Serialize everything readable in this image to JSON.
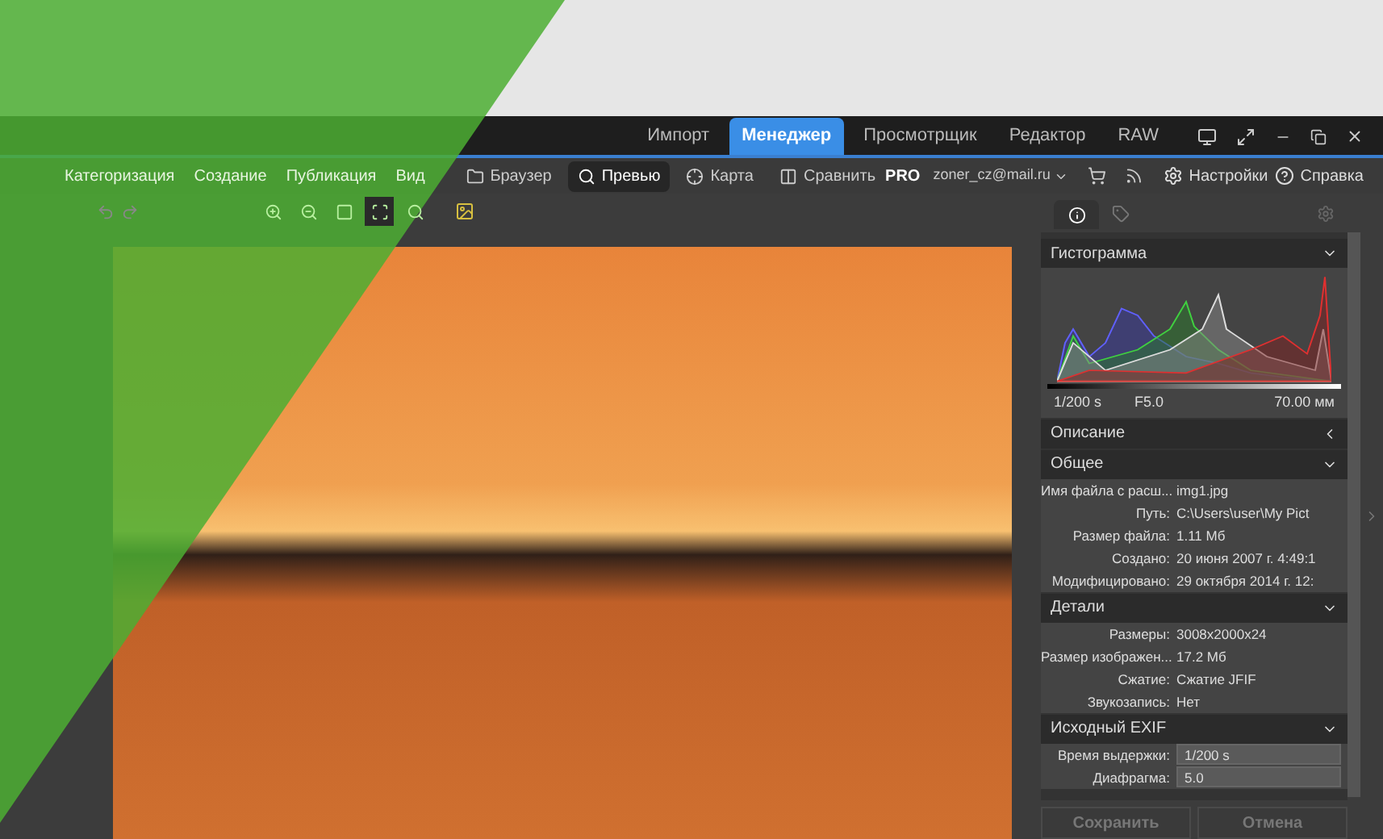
{
  "modules": [
    {
      "label": "Импорт",
      "selected": false
    },
    {
      "label": "Менеджер",
      "selected": true
    },
    {
      "label": "Просмотрщик",
      "selected": false
    },
    {
      "label": "Редактор",
      "selected": false
    },
    {
      "label": "RAW",
      "selected": false
    }
  ],
  "menu": [
    "Категоризация",
    "Создание",
    "Публикация",
    "Вид"
  ],
  "views": [
    {
      "label": "Браузер",
      "selected": false,
      "kind": "folder"
    },
    {
      "label": "Превью",
      "selected": true,
      "kind": "magnifier"
    },
    {
      "label": "Карта",
      "selected": false,
      "kind": "target"
    },
    {
      "label": "Сравнить",
      "selected": false,
      "kind": "compare"
    }
  ],
  "account": {
    "edition": "PRO",
    "email": "zoner_cz@mail.ru"
  },
  "links": [
    {
      "label": "Настройки",
      "kind": "gear"
    },
    {
      "label": "Справка",
      "kind": "help"
    }
  ],
  "tools": [
    {
      "kind": "zoom-in",
      "selected": false
    },
    {
      "kind": "zoom-out",
      "selected": false
    },
    {
      "kind": "actual",
      "selected": false
    },
    {
      "kind": "fit",
      "selected": true
    },
    {
      "kind": "zoom-find",
      "selected": false
    }
  ],
  "panel": {
    "histogram": {
      "title": "Гистограмма",
      "exposure": "1/200 s",
      "aperture": "F5.0",
      "focal": "70.00 мм"
    },
    "sections": [
      {
        "title": "Описание",
        "expanded": false
      },
      {
        "title": "Общее",
        "expanded": true,
        "rows": [
          {
            "label": "Имя файла с расш...",
            "value": "img1.jpg"
          },
          {
            "label": "Путь:",
            "value": "C:\\Users\\user\\My Pict"
          },
          {
            "label": "Размер файла:",
            "value": "1.11 Мб"
          },
          {
            "label": "Создано:",
            "value": "20 июня 2007 г. 4:49:1"
          },
          {
            "label": "Модифицировано:",
            "value": "29 октября 2014 г. 12:"
          }
        ]
      },
      {
        "title": "Детали",
        "expanded": true,
        "rows": [
          {
            "label": "Размеры:",
            "value": "3008x2000x24"
          },
          {
            "label": "Размер изображен...",
            "value": "17.2 Мб"
          },
          {
            "label": "Сжатие:",
            "value": "Сжатие JFIF"
          },
          {
            "label": "Звукозапись:",
            "value": "Нет"
          }
        ]
      },
      {
        "title": "Исходный EXIF",
        "expanded": true,
        "kind": "fields",
        "rows": [
          {
            "label": "Время выдержки:",
            "value": "1/200 s"
          },
          {
            "label": "Диафрагма:",
            "value": "5.0"
          }
        ]
      }
    ],
    "buttons": [
      "Сохранить",
      "Отмена"
    ]
  }
}
